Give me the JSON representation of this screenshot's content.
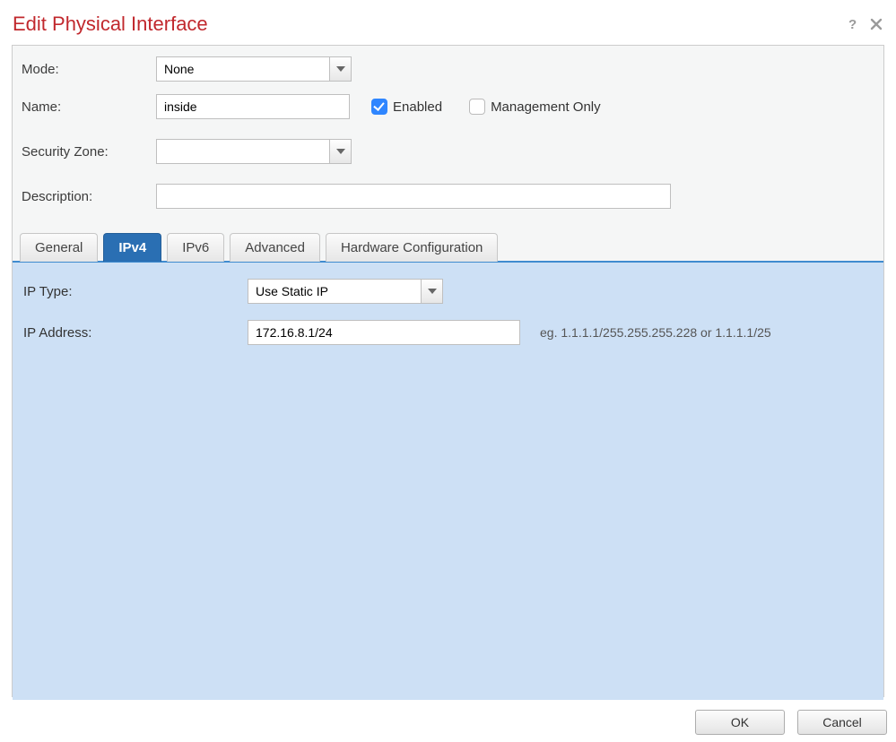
{
  "dialog": {
    "title": "Edit Physical Interface"
  },
  "form": {
    "mode": {
      "label": "Mode:",
      "value": "None"
    },
    "name": {
      "label": "Name:",
      "value": "inside"
    },
    "enabled": {
      "label": "Enabled",
      "checked": true
    },
    "management_only": {
      "label": "Management Only",
      "checked": false
    },
    "security_zone": {
      "label": "Security Zone:",
      "value": ""
    },
    "description": {
      "label": "Description:",
      "value": ""
    }
  },
  "tabs": {
    "general": "General",
    "ipv4": "IPv4",
    "ipv6": "IPv6",
    "advanced": "Advanced",
    "hardware": "Hardware Configuration",
    "active": "ipv4"
  },
  "ipv4": {
    "ip_type": {
      "label": "IP Type:",
      "value": "Use Static IP"
    },
    "ip_address": {
      "label": "IP Address:",
      "value": "172.16.8.1/24",
      "hint": "eg. 1.1.1.1/255.255.255.228 or 1.1.1.1/25"
    }
  },
  "footer": {
    "ok": "OK",
    "cancel": "Cancel"
  }
}
